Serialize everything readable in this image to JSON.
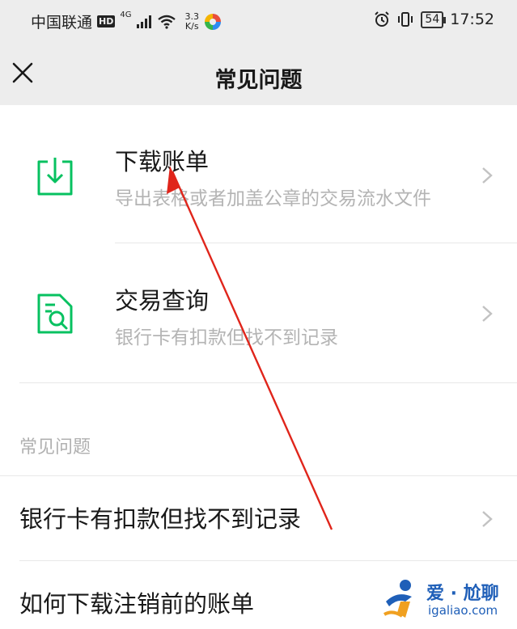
{
  "status_bar": {
    "carrier": "中国联通",
    "hd_badge": "HD",
    "network": "4G",
    "speed_value": "3.3",
    "speed_unit": "K/s",
    "battery": "54",
    "time": "17:52"
  },
  "nav": {
    "title": "常见问题"
  },
  "cards": [
    {
      "title": "下载账单",
      "subtitle": "导出表格或者加盖公章的交易流水文件",
      "icon": "download-icon"
    },
    {
      "title": "交易查询",
      "subtitle": "银行卡有扣款但找不到记录",
      "icon": "search-document-icon"
    }
  ],
  "faq": {
    "section_title": "常见问题",
    "items": [
      {
        "label": "银行卡有扣款但找不到记录"
      },
      {
        "label": "如何下载注销前的账单"
      }
    ]
  },
  "watermark": {
    "name": "爱 · 尬聊",
    "url": "igaliao.com"
  },
  "colors": {
    "accent_green": "#07c160",
    "annotation_red": "#e0251b",
    "header_bg": "#ededed"
  }
}
